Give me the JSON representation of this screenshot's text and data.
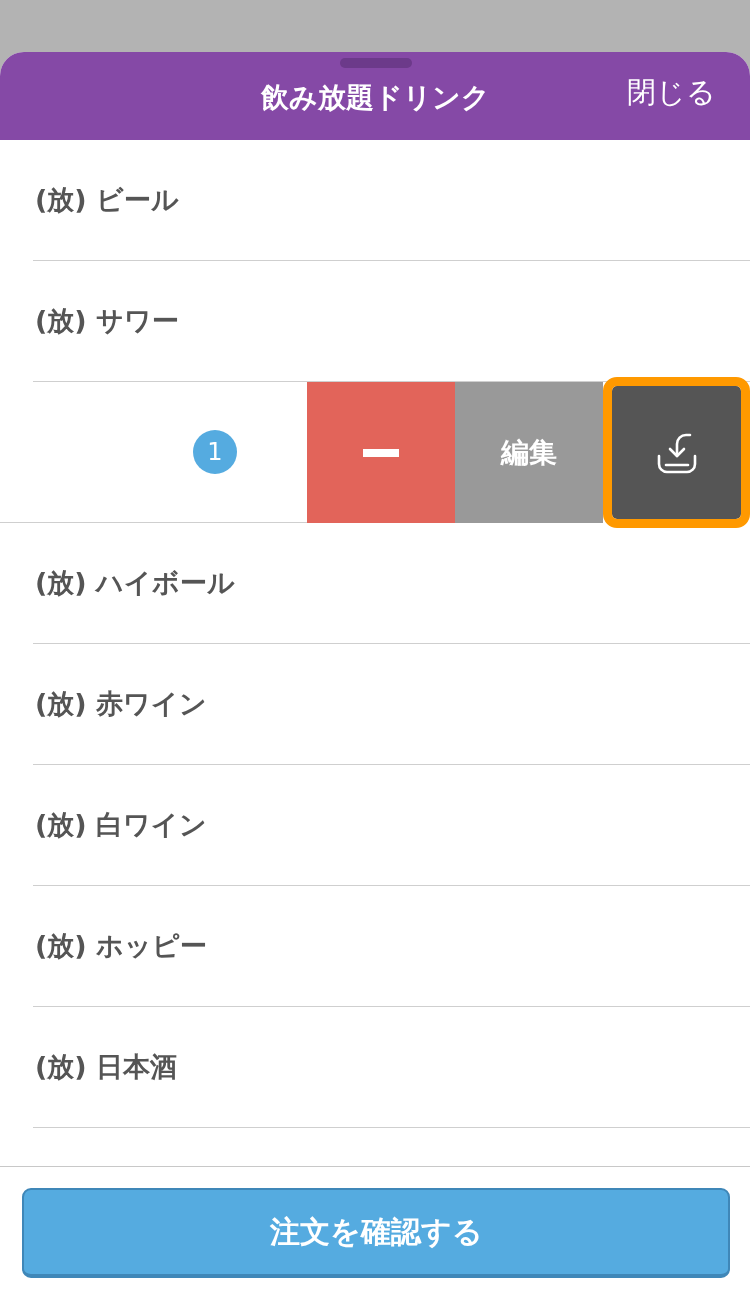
{
  "sheet": {
    "title": "飲み放題ドリンク",
    "close": "閉じる"
  },
  "items": [
    {
      "kind": "item",
      "name": "(放) ビール"
    },
    {
      "kind": "item",
      "name": "(放) サワー"
    },
    {
      "kind": "swiped",
      "count": "1",
      "actions": [
        {
          "kind": "minus",
          "focused": false
        },
        {
          "kind": "edit",
          "label": "編集",
          "focused": false
        },
        {
          "kind": "tray",
          "focused": true
        }
      ]
    },
    {
      "kind": "item",
      "name": "(放) ハイボール"
    },
    {
      "kind": "item",
      "name": "(放) 赤ワイン"
    },
    {
      "kind": "item",
      "name": "(放) 白ワイン"
    },
    {
      "kind": "item",
      "name": "(放) ホッピー"
    },
    {
      "kind": "item",
      "name": "(放) 日本酒"
    }
  ],
  "footer": {
    "button": "注文を確認する"
  }
}
